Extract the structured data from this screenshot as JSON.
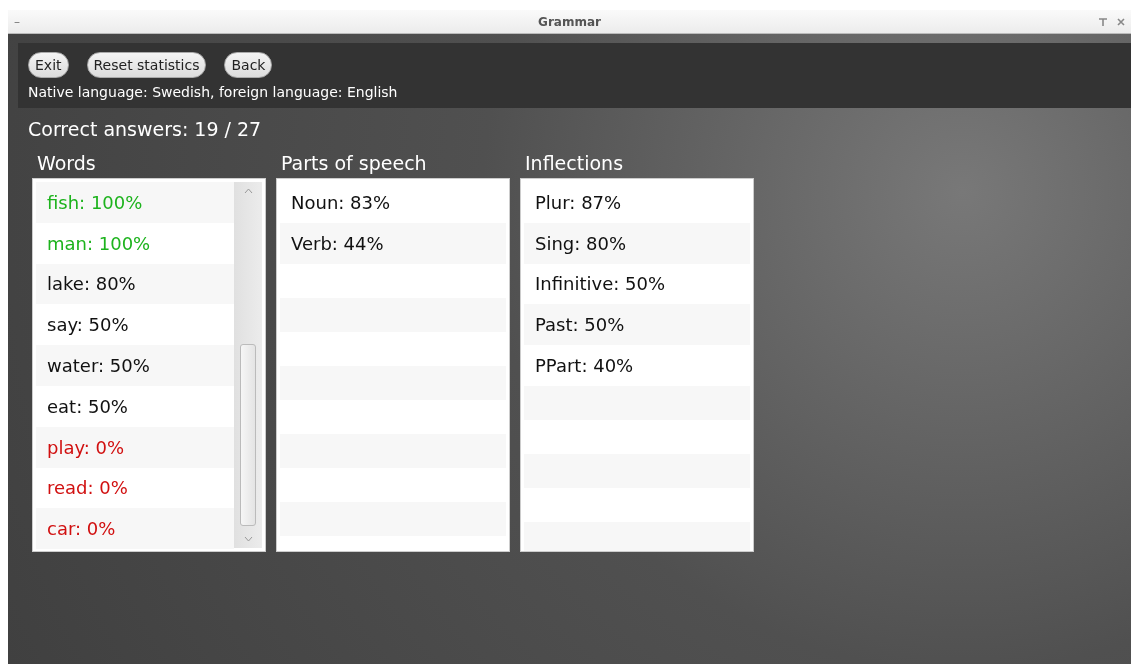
{
  "window": {
    "title": "Grammar",
    "minimize": "–"
  },
  "toolbar": {
    "buttons": [
      "Exit",
      "Reset statistics",
      "Back"
    ],
    "info": "Native language: Swedish, foreign language: English"
  },
  "score": "Correct answers: 19 / 27",
  "lists": [
    {
      "title": "Words",
      "scrollable": true,
      "items": [
        {
          "text": "fish: 100%",
          "color": "#1db31d"
        },
        {
          "text": "man: 100%",
          "color": "#1db31d"
        },
        {
          "text": "lake: 80%",
          "color": "#111111"
        },
        {
          "text": "say: 50%",
          "color": "#111111"
        },
        {
          "text": "water: 50%",
          "color": "#111111"
        },
        {
          "text": "eat: 50%",
          "color": "#111111"
        },
        {
          "text": "play: 0%",
          "color": "#d11010"
        },
        {
          "text": "read: 0%",
          "color": "#d11010"
        },
        {
          "text": "car: 0%",
          "color": "#d11010"
        }
      ]
    },
    {
      "title": "Parts of speech",
      "scrollable": false,
      "items": [
        {
          "text": "Noun: 83%",
          "color": "#111111"
        },
        {
          "text": "Verb: 44%",
          "color": "#111111"
        }
      ]
    },
    {
      "title": "Inflections",
      "scrollable": false,
      "items": [
        {
          "text": "Plur: 87%",
          "color": "#111111"
        },
        {
          "text": "Sing: 80%",
          "color": "#111111"
        },
        {
          "text": "Infinitive: 50%",
          "color": "#111111"
        },
        {
          "text": "Past: 50%",
          "color": "#111111"
        },
        {
          "text": "PPart: 40%",
          "color": "#111111"
        }
      ]
    }
  ]
}
